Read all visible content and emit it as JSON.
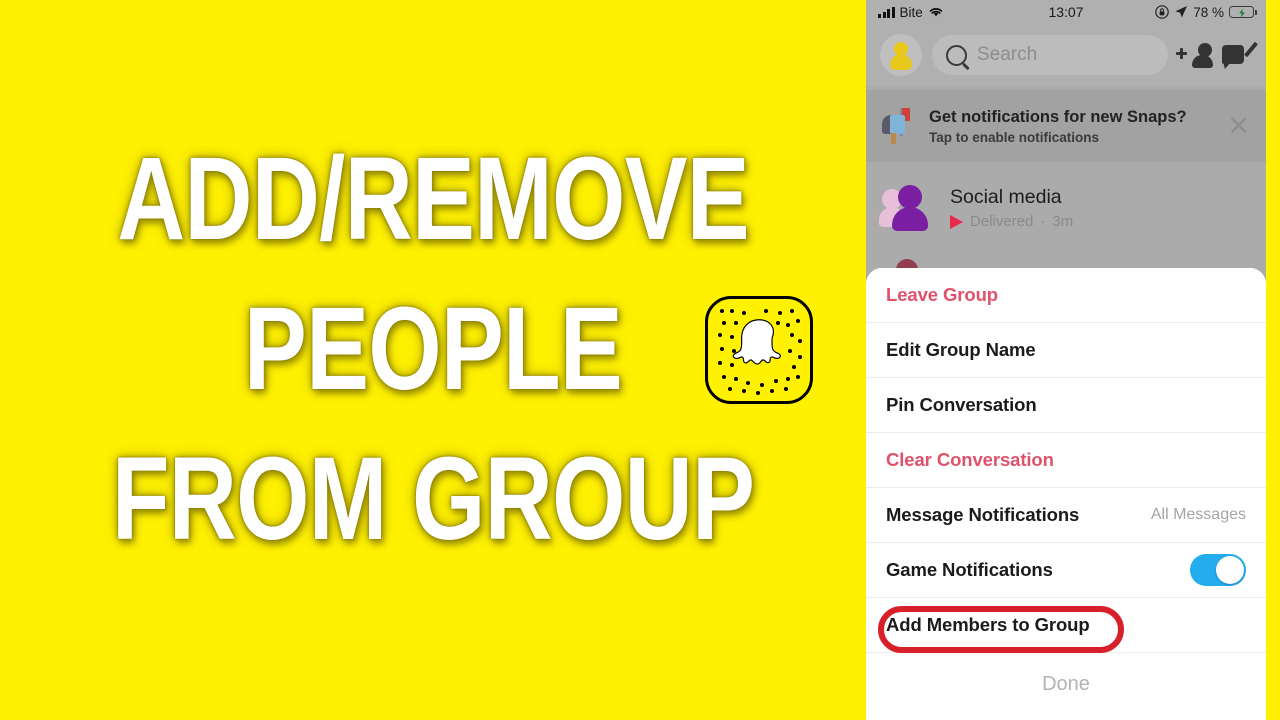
{
  "thumbnail": {
    "background_color": "#FFF100",
    "title_lines": [
      "ADD/REMOVE",
      "PEOPLE",
      "FROM GROUP"
    ],
    "logo": "snapcode-ghost-icon"
  },
  "phone": {
    "status_bar": {
      "signal": "signal-bars-icon",
      "carrier": "Bite",
      "wifi": "wifi-icon",
      "time": "13:07",
      "rotation_lock": "rotation-lock-icon",
      "location": "location-arrow-icon",
      "battery_percent": "78 %",
      "battery": "battery-charging-icon"
    },
    "header": {
      "avatar": "profile-avatar-icon",
      "search_placeholder": "Search",
      "search_icon": "search-icon",
      "add_friend_icon": "add-friend-icon",
      "compose_icon": "new-chat-icon"
    },
    "notification_banner": {
      "icon": "mailbox-icon",
      "title": "Get notifications for new Snaps?",
      "subtitle": "Tap to enable notifications",
      "close_icon": "close-icon"
    },
    "chat_list": [
      {
        "avatar": "group-avatar-icon",
        "name": "Social media",
        "status_icon": "sent-arrow-icon",
        "status": "Delivered",
        "separator": "·",
        "time": "3m"
      }
    ],
    "obscured_row_text": "",
    "action_sheet": {
      "items": [
        {
          "label": "Leave Group",
          "style": "destructive",
          "value": null,
          "control": null
        },
        {
          "label": "Edit Group Name",
          "style": "default",
          "value": null,
          "control": null
        },
        {
          "label": "Pin Conversation",
          "style": "default",
          "value": null,
          "control": null
        },
        {
          "label": "Clear Conversation",
          "style": "destructive",
          "value": null,
          "control": null
        },
        {
          "label": "Message Notifications",
          "style": "default",
          "value": "All Messages",
          "control": null
        },
        {
          "label": "Game Notifications",
          "style": "default",
          "value": null,
          "control": "toggle-on"
        },
        {
          "label": "Add Members to Group",
          "style": "default",
          "value": null,
          "control": null
        }
      ],
      "done_label": "Done",
      "highlighted_item_index": 6,
      "highlight_color": "#D8202A"
    }
  },
  "colors": {
    "brand_yellow": "#FFF100",
    "destructive_red": "#E0526B",
    "toggle_blue": "#23ADEF",
    "annotation_red": "#D8202A",
    "dimmed_backdrop": "#ABABAB"
  }
}
